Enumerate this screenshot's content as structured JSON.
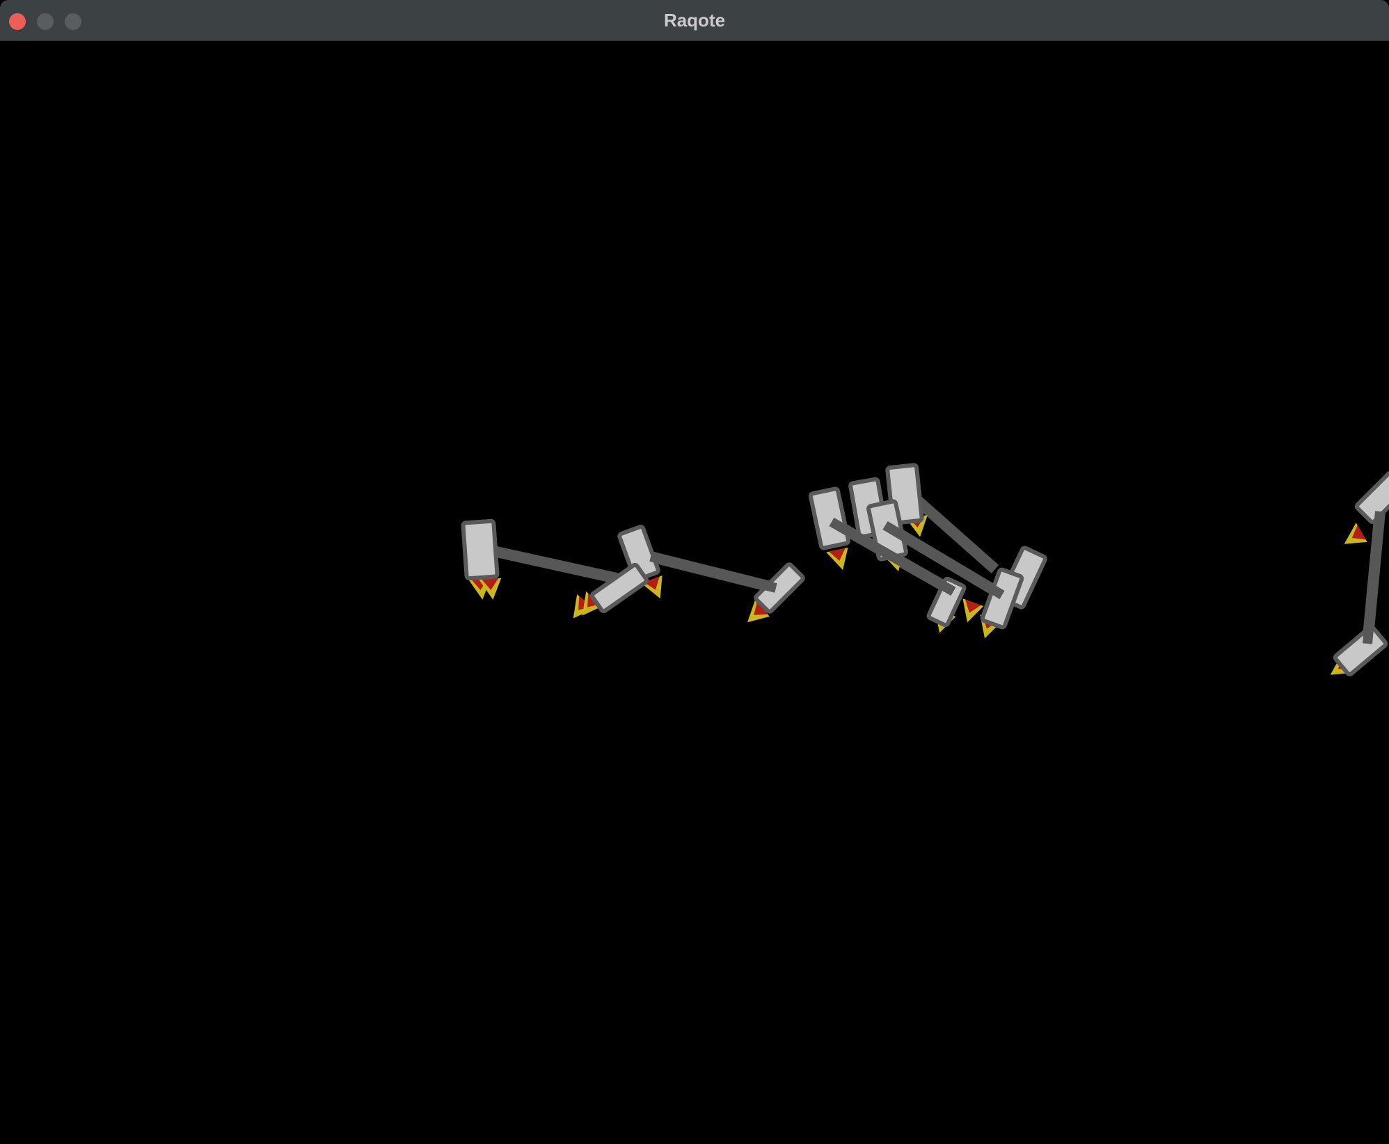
{
  "window": {
    "title": "Raqote",
    "controls": {
      "close_color": "#ee5e57",
      "minimize_color": "#595d60",
      "zoom_color": "#595d60"
    }
  },
  "canvas": {
    "background": "#000000",
    "colors": {
      "body_fill": "#c8c8c8",
      "body_stroke": "#5a5a5a",
      "link": "#575757",
      "flame_outer": "#c8b81e",
      "flame_inner": "#b41e14"
    }
  }
}
